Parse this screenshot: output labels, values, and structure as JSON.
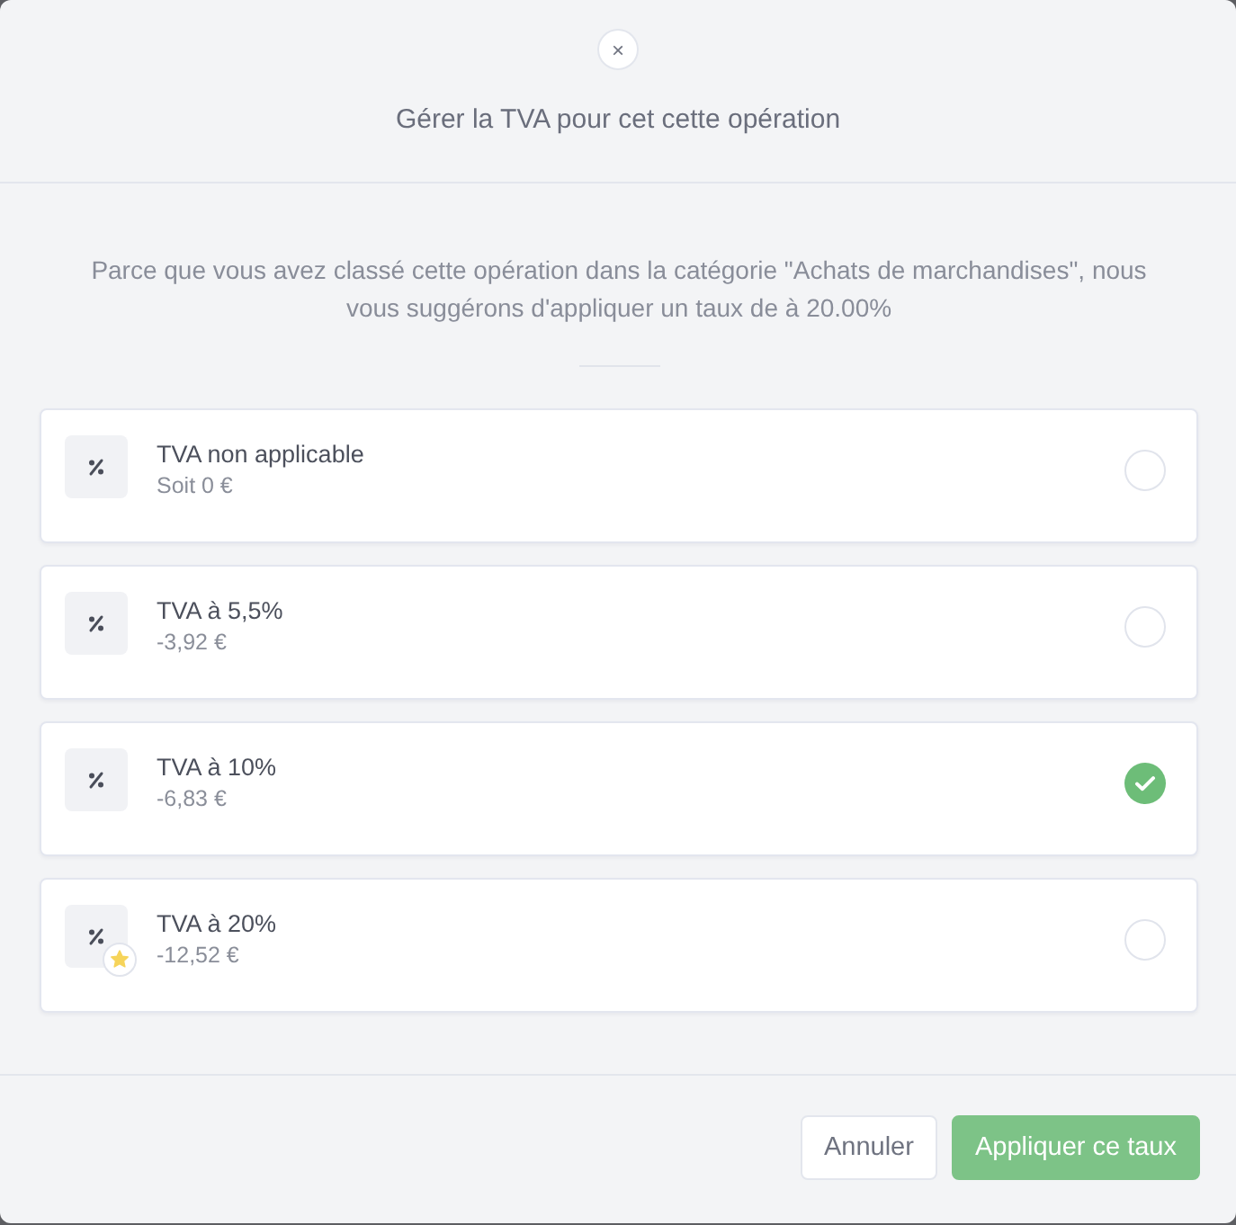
{
  "dialog": {
    "close_button": "×",
    "title": "Gérer la TVA pour cet cette opération"
  },
  "message": "Parce que vous avez classé cette opération dans la catégorie \"Achats de marchandises\", nous vous suggérons d'appliquer un taux de à 20.00%",
  "options": [
    {
      "label": "TVA non applicable",
      "amount": "Soit 0 €",
      "selected": false,
      "recommended": false
    },
    {
      "label": "TVA à 5,5%",
      "amount": "-3,92 €",
      "selected": false,
      "recommended": false
    },
    {
      "label": "TVA à 10%",
      "amount": "-6,83 €",
      "selected": true,
      "recommended": false
    },
    {
      "label": "TVA à 20%",
      "amount": "-12,52 €",
      "selected": false,
      "recommended": true
    }
  ],
  "buttons": [
    {
      "label": "Annuler",
      "kind": "secondary"
    },
    {
      "label": "Appliquer ce taux",
      "kind": "primary"
    }
  ]
}
